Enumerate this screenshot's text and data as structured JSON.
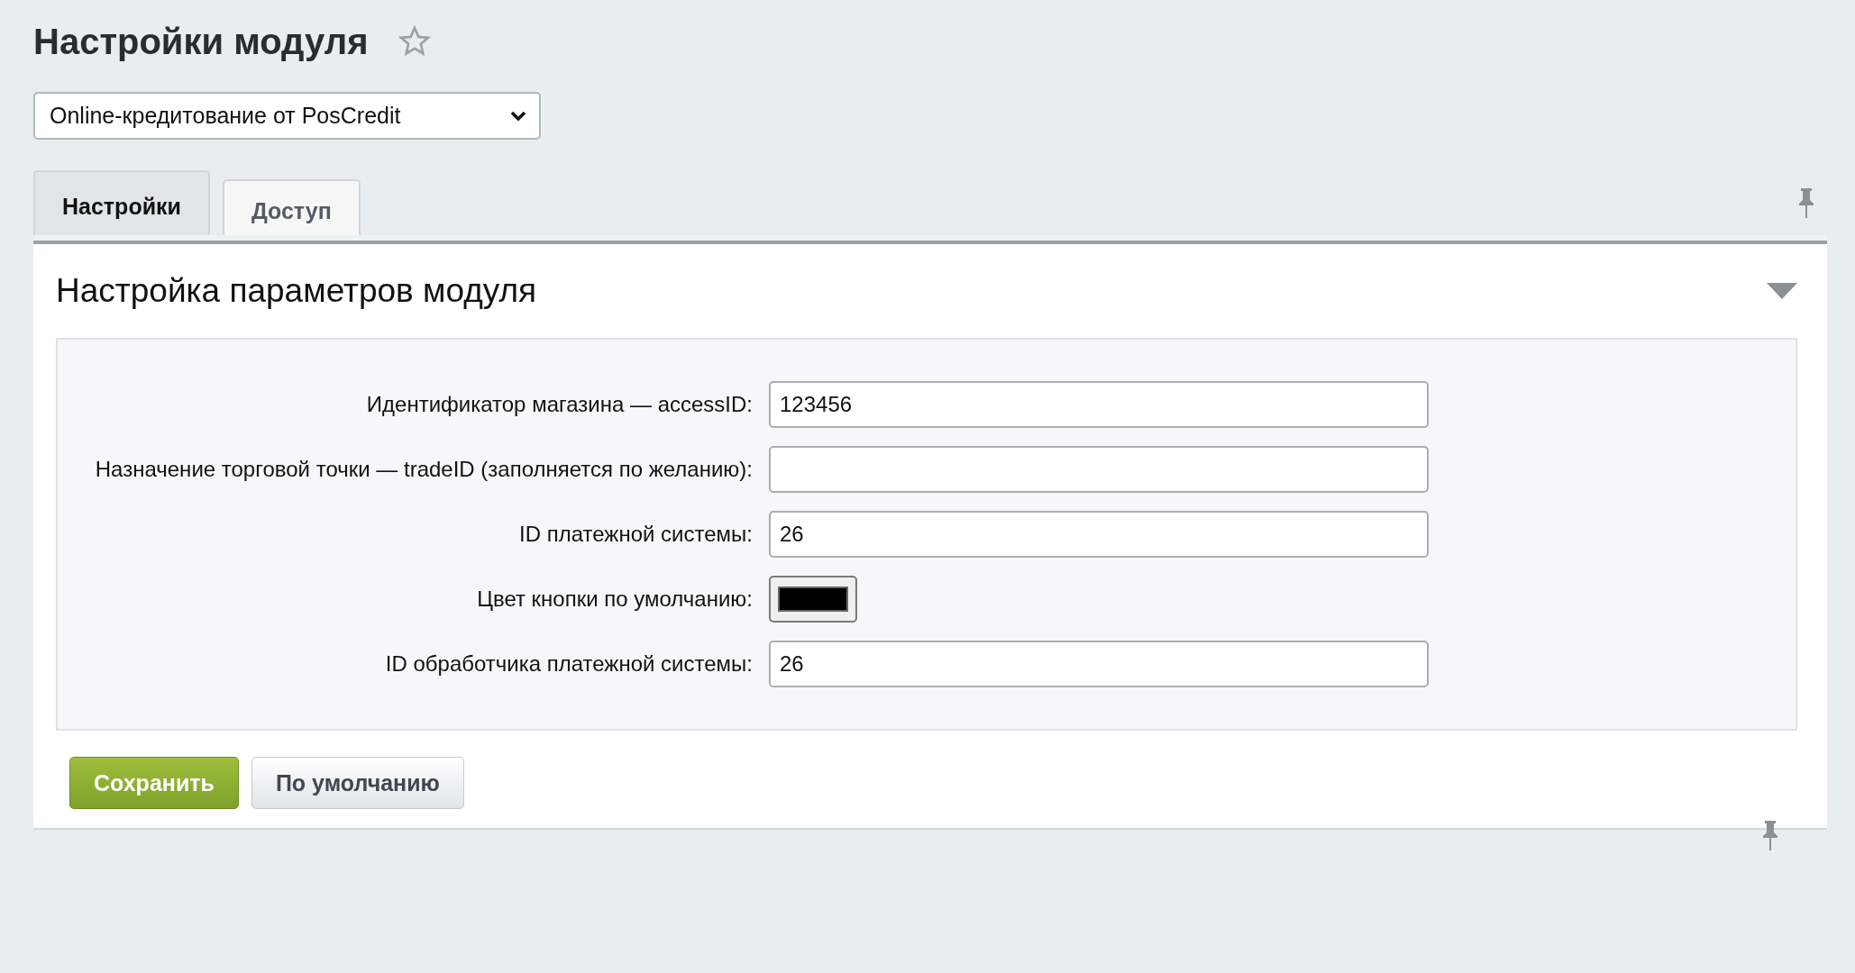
{
  "page": {
    "title": "Настройки модуля"
  },
  "module_select": {
    "value": "Online-кредитование от PosCredit"
  },
  "tabs": [
    {
      "label": "Настройки",
      "selected": true
    },
    {
      "label": "Доступ",
      "selected": false
    }
  ],
  "section": {
    "title": "Настройка параметров модуля",
    "expanded": true
  },
  "fields": [
    {
      "kind": "text",
      "label": "Идентификатор магазина — accessID:",
      "value": "123456"
    },
    {
      "kind": "text",
      "label": "Назначение торговой точки — tradeID (заполняется по желанию):"
    },
    {
      "kind": "text",
      "label": "ID платежной системы:",
      "value": "26"
    },
    {
      "kind": "color",
      "label": "Цвет кнопки по умолчанию:",
      "color": "#000000"
    },
    {
      "kind": "text",
      "label": "ID обработчика платежной системы:",
      "value": "26"
    }
  ],
  "buttons": [
    {
      "kind": "primary",
      "label": "Сохранить"
    },
    {
      "kind": "secondary",
      "label": "По умолчанию"
    }
  ]
}
